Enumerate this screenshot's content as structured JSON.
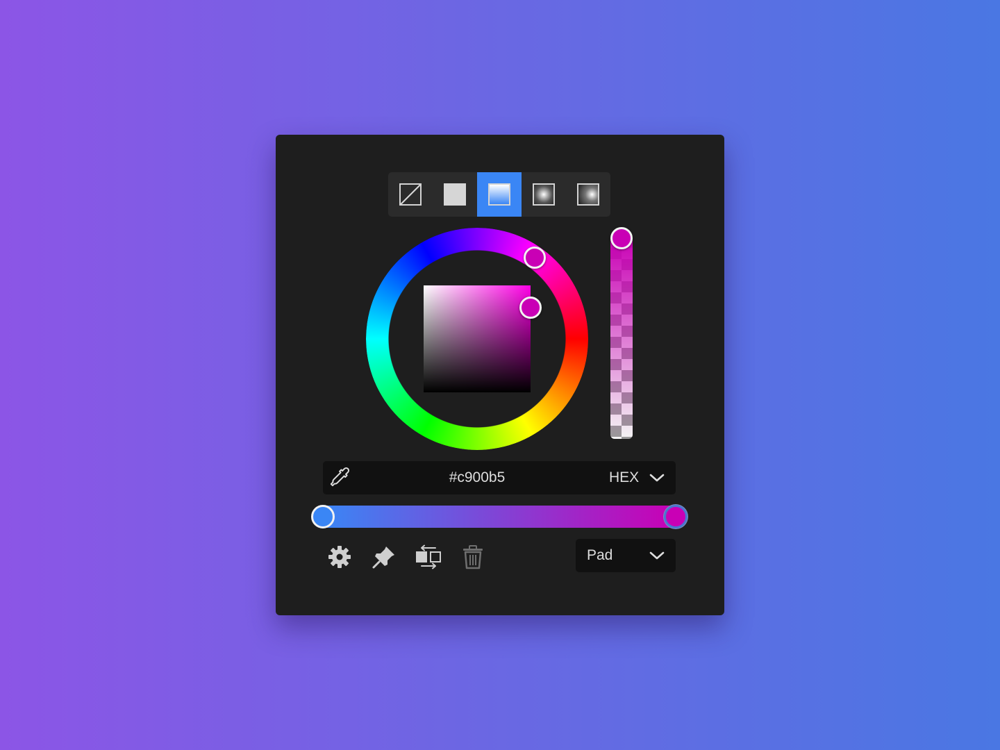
{
  "fill_types": [
    {
      "name": "none",
      "icon": "no-fill-icon",
      "active": false
    },
    {
      "name": "solid",
      "icon": "solid-fill-icon",
      "active": false
    },
    {
      "name": "linear",
      "icon": "linear-gradient-icon",
      "active": true
    },
    {
      "name": "radial",
      "icon": "radial-gradient-icon",
      "active": false
    },
    {
      "name": "angular",
      "icon": "angular-gradient-icon",
      "active": false
    }
  ],
  "color": {
    "hex": "#c900b5",
    "format": "HEX",
    "hue": 305,
    "saturation": 1.0,
    "value": 0.79,
    "alpha": 1.0
  },
  "gradient": {
    "stops": [
      {
        "color": "#3a86f5",
        "position": 0
      },
      {
        "color": "#c900b5",
        "position": 1,
        "selected": true
      }
    ],
    "spread": "Pad"
  },
  "tools": [
    "settings-icon",
    "pin-icon",
    "swap-icon",
    "trash-icon"
  ],
  "colors": {
    "panel": "#1e1e1e",
    "accent": "#3a86f5",
    "selected_color": "#c900b5"
  }
}
